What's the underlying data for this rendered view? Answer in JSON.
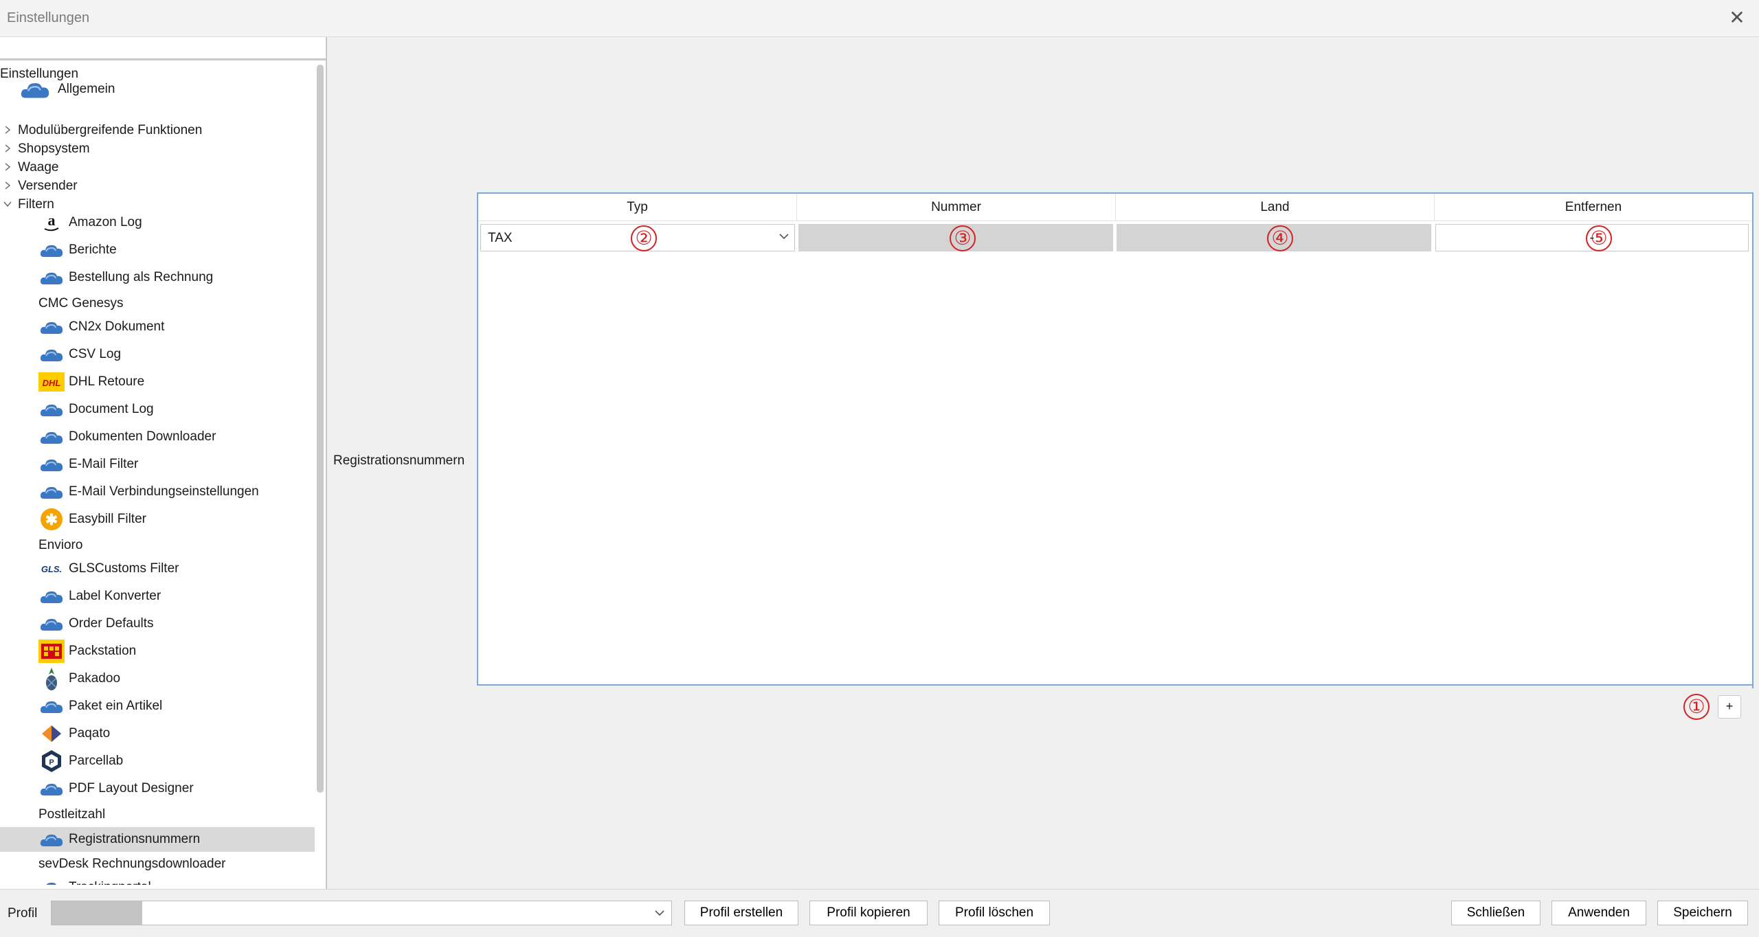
{
  "window": {
    "title": "Einstellungen",
    "close_glyph": "✕"
  },
  "tree": {
    "root_label": "Einstellungen",
    "items": [
      {
        "label": "Allgemein",
        "icon": "cloud-icon"
      },
      {
        "label": "Modulübergreifende Funktionen",
        "icon": ""
      },
      {
        "label": "Shopsystem",
        "icon": ""
      },
      {
        "label": "Waage",
        "icon": ""
      },
      {
        "label": "Versender",
        "icon": ""
      },
      {
        "label": "Filtern",
        "icon": ""
      },
      {
        "label": "Amazon Log",
        "icon": "amazon-icon"
      },
      {
        "label": "Berichte",
        "icon": "cloud-icon"
      },
      {
        "label": "Bestellung als Rechnung",
        "icon": "cloud-icon"
      },
      {
        "label": "CMC Genesys",
        "icon": ""
      },
      {
        "label": "CN2x Dokument",
        "icon": "cloud-icon"
      },
      {
        "label": "CSV Log",
        "icon": "cloud-icon"
      },
      {
        "label": "DHL Retoure",
        "icon": "dhl-icon"
      },
      {
        "label": "Document Log",
        "icon": "cloud-icon"
      },
      {
        "label": "Dokumenten Downloader",
        "icon": "cloud-icon"
      },
      {
        "label": "E-Mail Filter",
        "icon": "cloud-icon"
      },
      {
        "label": "E-Mail Verbindungseinstellungen",
        "icon": "cloud-icon"
      },
      {
        "label": "Easybill Filter",
        "icon": "easybill-icon"
      },
      {
        "label": "Envioro",
        "icon": ""
      },
      {
        "label": "GLSCustoms Filter",
        "icon": "gls-icon"
      },
      {
        "label": "Label Konverter",
        "icon": "cloud-icon"
      },
      {
        "label": "Order Defaults",
        "icon": "cloud-icon"
      },
      {
        "label": "Packstation",
        "icon": "packstation-icon"
      },
      {
        "label": "Pakadoo",
        "icon": "pineapple-icon"
      },
      {
        "label": "Paket ein Artikel",
        "icon": "cloud-icon"
      },
      {
        "label": "Paqato",
        "icon": "paqato-icon"
      },
      {
        "label": "Parcellab",
        "icon": "parcellab-icon"
      },
      {
        "label": "PDF Layout Designer",
        "icon": "cloud-icon"
      },
      {
        "label": "Postleitzahl",
        "icon": ""
      },
      {
        "label": "Registrationsnummern",
        "icon": "cloud-icon"
      },
      {
        "label": "sevDesk Rechnungsdownloader",
        "icon": ""
      },
      {
        "label": "Trackingportal",
        "icon": "cloud-icon"
      }
    ]
  },
  "content": {
    "field_label": "Registrationsnummern",
    "grid": {
      "columns": [
        "Typ",
        "Nummer",
        "Land",
        "Entfernen"
      ],
      "rows": [
        {
          "typ": "TAX",
          "nummer": "",
          "land": "",
          "entfernen": "-"
        }
      ]
    },
    "markers": [
      "1",
      "2",
      "3",
      "4",
      "5"
    ],
    "marker_glyphs": [
      "①",
      "②",
      "③",
      "④",
      "⑤"
    ],
    "add_label": "+"
  },
  "bottom": {
    "profile_label": "Profil",
    "profile_value": "",
    "profile_fill_fraction": 0.146,
    "buttons": {
      "create": "Profil erstellen",
      "copy": "Profil kopieren",
      "delete": "Profil löschen",
      "close": "Schließen",
      "apply": "Anwenden",
      "save": "Speichern"
    }
  },
  "colors": {
    "accent_blue": "#7ea6d8",
    "marker_red": "#d32222",
    "selected_row": "#d9d9d9",
    "cloud_blue": "#3a78c4"
  }
}
